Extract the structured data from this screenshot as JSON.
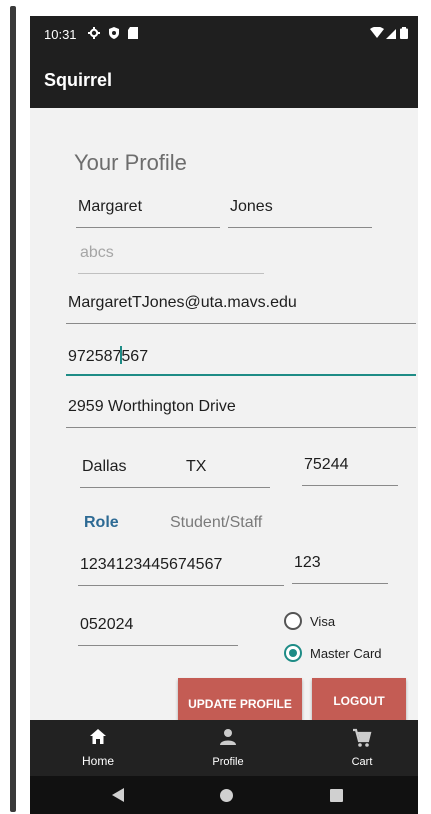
{
  "status_bar": {
    "time": "10:31"
  },
  "app_bar": {
    "title": "Squirrel"
  },
  "profile": {
    "heading": "Your Profile",
    "first_name": "Margaret",
    "last_name": "Jones",
    "middle_placeholder": "abcs",
    "email": "MargaretTJones@uta.mavs.edu",
    "phone_before_cursor": "972587",
    "phone_after_cursor": "567",
    "address": "2959 Worthington Drive",
    "city": "Dallas",
    "state": "TX",
    "zip": "75244",
    "role_label": "Role",
    "role_value": "Student/Staff",
    "card_number": "1234123445674567",
    "cvv": "123",
    "expiry": "052024",
    "payment_options": [
      {
        "label": "Visa",
        "checked": false
      },
      {
        "label": "Master Card",
        "checked": true
      }
    ],
    "update_button": "UPDATE PROFILE",
    "logout_button": "LOGOUT"
  },
  "bottom_nav": [
    {
      "label": "Home",
      "icon": "home-icon"
    },
    {
      "label": "Profile",
      "icon": "person-icon"
    },
    {
      "label": "Cart",
      "icon": "cart-icon"
    }
  ],
  "colors": {
    "app_bar": "#1f1f1f",
    "accent": "#1e8c86",
    "button": "#c45c54",
    "role_label": "#2d6a94"
  }
}
